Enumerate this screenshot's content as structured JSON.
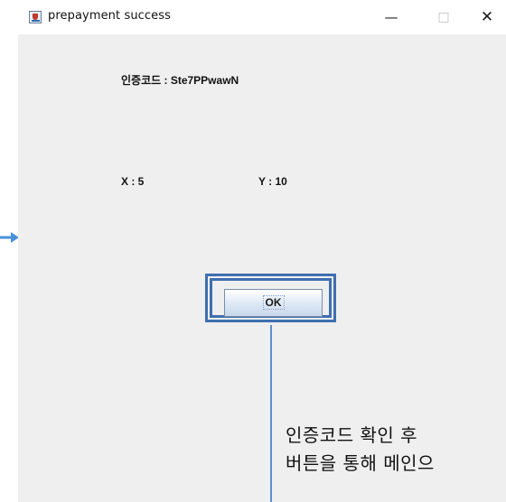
{
  "window": {
    "title": "prepayment success",
    "minimize_glyph": "—",
    "maximize_glyph": "□",
    "close_glyph": "✕"
  },
  "content": {
    "auth_code_label": "인증코드 : Ste7PPwawN",
    "x_label": "X : 5",
    "y_label": "Y : 10",
    "ok_label": "OK"
  },
  "annotation": {
    "line1": "인증코드 확인 후",
    "line2": "버튼을 통해 메인으"
  },
  "icons": {
    "app": "java-coffee-icon",
    "arrow": "right-arrow-icon"
  },
  "colors": {
    "highlight": "#3f6fb0",
    "callout_line": "#5b8fd0",
    "arrow": "#4a90d9",
    "window_bg": "#efefef"
  }
}
